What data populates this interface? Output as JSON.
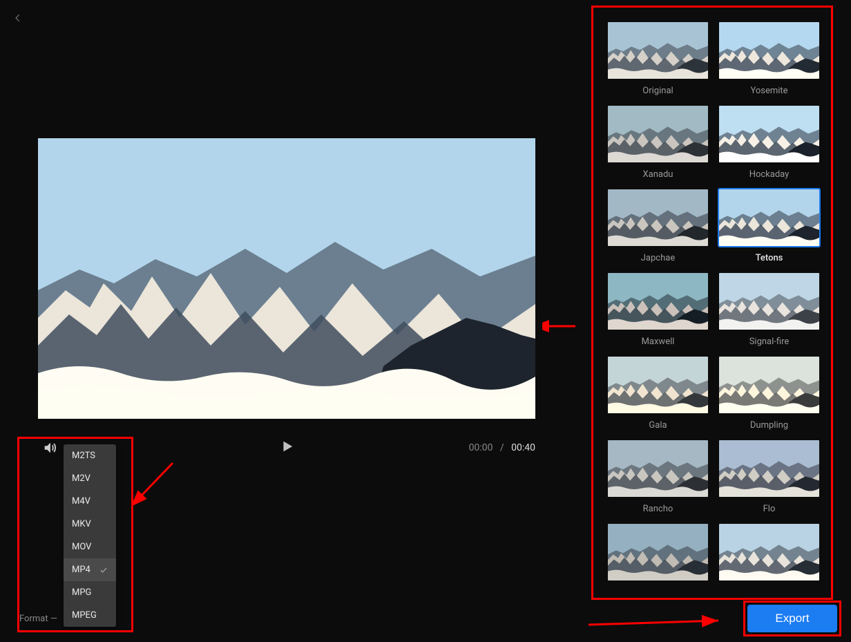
{
  "playback": {
    "current_time": "00:00",
    "total_time": "00:40",
    "separator": "/"
  },
  "format_dropdown": {
    "label": "Format  —",
    "options": [
      "M2TS",
      "M2V",
      "M4V",
      "MKV",
      "MOV",
      "MP4",
      "MPG",
      "MPEG"
    ],
    "selected": "MP4"
  },
  "filters": {
    "selected": "Tetons",
    "items": [
      {
        "label": "Original",
        "class": "f-original"
      },
      {
        "label": "Yosemite",
        "class": "f-yosemite"
      },
      {
        "label": "Xanadu",
        "class": "f-xanadu"
      },
      {
        "label": "Hockaday",
        "class": "f-hockaday"
      },
      {
        "label": "Japchae",
        "class": "f-japchae"
      },
      {
        "label": "Tetons",
        "class": "f-tetons"
      },
      {
        "label": "Maxwell",
        "class": "f-maxwell"
      },
      {
        "label": "Signal-fire",
        "class": "f-signalfire"
      },
      {
        "label": "Gala",
        "class": "f-gala"
      },
      {
        "label": "Dumpling",
        "class": "f-dumpling"
      },
      {
        "label": "Rancho",
        "class": "f-rancho"
      },
      {
        "label": "Flo",
        "class": "f-flo"
      },
      {
        "label": "",
        "class": "f-a"
      },
      {
        "label": "",
        "class": "f-b"
      }
    ]
  },
  "actions": {
    "export": "Export"
  }
}
